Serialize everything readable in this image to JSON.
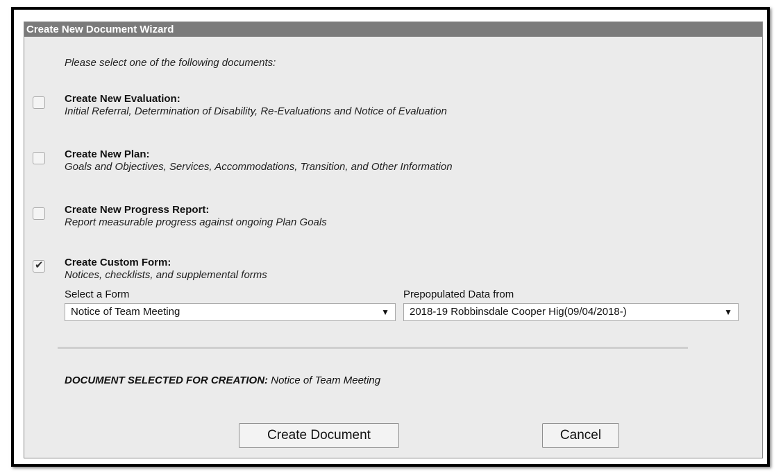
{
  "wizard": {
    "title": "Create New Document Wizard",
    "intro": "Please select one of the following documents:",
    "options": [
      {
        "title": "Create New Evaluation:",
        "description": "Initial Referral, Determination of Disability, Re-Evaluations and Notice of Evaluation",
        "checked": false
      },
      {
        "title": "Create New Plan:",
        "description": "Goals and Objectives, Services, Accommodations, Transition, and Other Information",
        "checked": false
      },
      {
        "title": "Create New Progress Report:",
        "description": "Report measurable progress against ongoing Plan Goals",
        "checked": false
      },
      {
        "title": "Create Custom Form:",
        "description": "Notices, checklists, and supplemental forms",
        "checked": true
      }
    ],
    "form_select": {
      "label": "Select a Form",
      "value": "Notice of Team Meeting"
    },
    "prepop_select": {
      "label": "Prepopulated Data from",
      "value": "2018-19 Robbinsdale Cooper Hig(09/04/2018-)"
    },
    "selected_label": "DOCUMENT SELECTED FOR CREATION:",
    "selected_value": "Notice of Team Meeting",
    "buttons": {
      "create": "Create Document",
      "cancel": "Cancel"
    },
    "icons": {
      "checkbox_checked": "check-icon",
      "dropdown": "triangle-down-icon"
    },
    "colors": {
      "title_bar": "#7b7b7b",
      "panel": "#ebebeb"
    }
  }
}
